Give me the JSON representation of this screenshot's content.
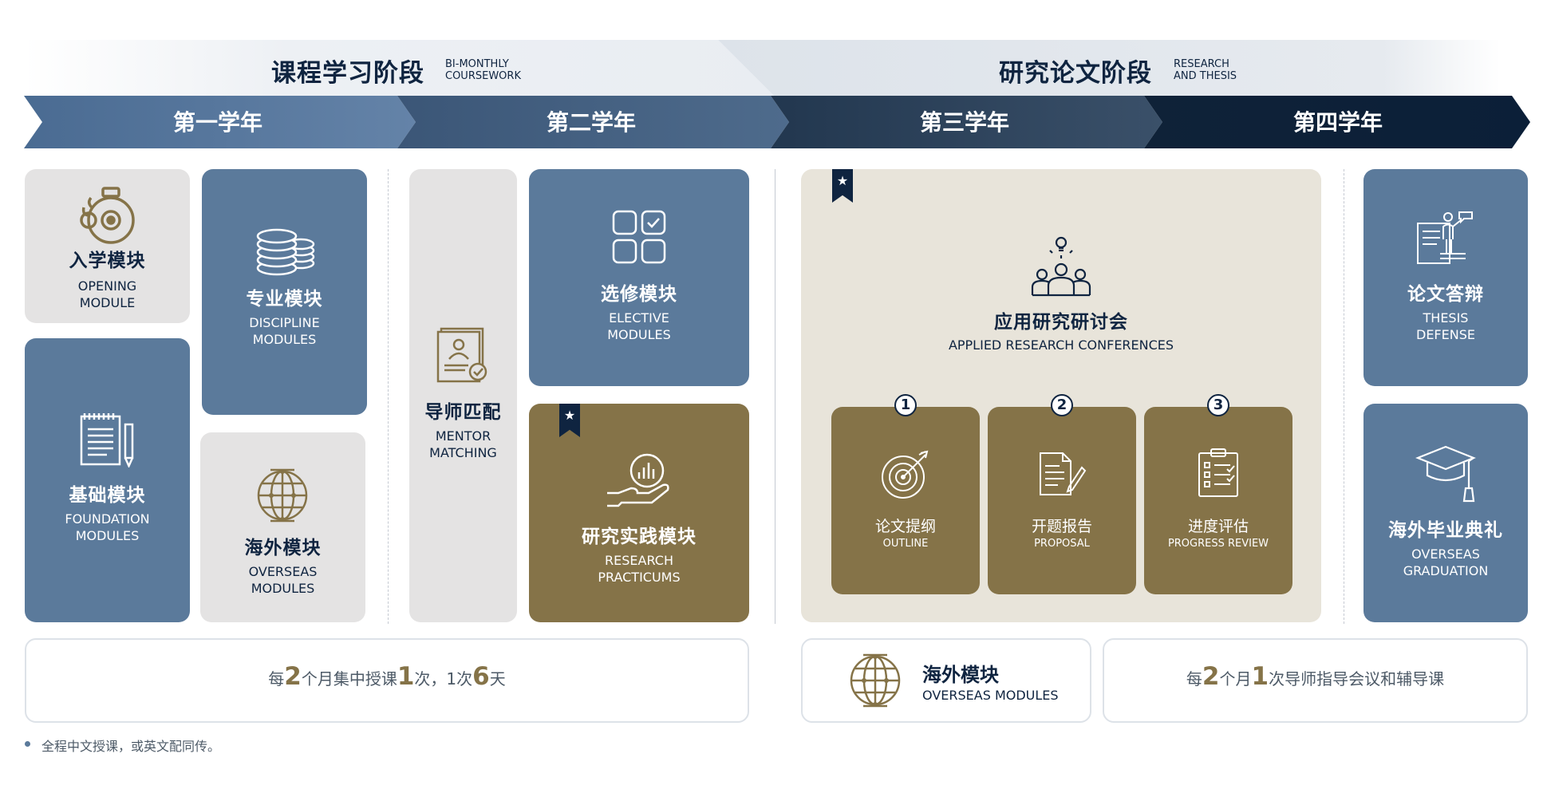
{
  "phases": [
    {
      "title": "课程学习阶段",
      "sub_line1": "BI-MONTHLY",
      "sub_line2": "COURSEWORK"
    },
    {
      "title": "研究论文阶段",
      "sub_line1": "RESEARCH",
      "sub_line2": "AND THESIS"
    }
  ],
  "years": [
    "第一学年",
    "第二学年",
    "第三学年",
    "第四学年"
  ],
  "colors": {
    "blue": "#5b7a9b",
    "grey": "#e4e3e3",
    "gold": "#857348",
    "navy": "#0f2440",
    "beige": "#e8e4da"
  },
  "modules": {
    "opening": {
      "zh": "入学模块",
      "en1": "OPENING",
      "en2": "MODULE",
      "icon": "bell-icon"
    },
    "discipline": {
      "zh": "专业模块",
      "en1": "DISCIPLINE",
      "en2": "MODULES",
      "icon": "coins-icon"
    },
    "foundation": {
      "zh": "基础模块",
      "en1": "FOUNDATION",
      "en2": "MODULES",
      "icon": "notepad-pen-icon"
    },
    "overseas": {
      "zh": "海外模块",
      "en1": "OVERSEAS",
      "en2": "MODULES",
      "icon": "globe-icon"
    },
    "mentor": {
      "zh": "导师匹配",
      "en1": "MENTOR",
      "en2": "MATCHING",
      "icon": "certificate-icon"
    },
    "elective": {
      "zh": "选修模块",
      "en1": "ELECTIVE",
      "en2": "MODULES",
      "icon": "grid-check-icon"
    },
    "practicum": {
      "zh": "研究实践模块",
      "en1": "RESEARCH",
      "en2": "PRACTICUMS",
      "icon": "hand-chart-icon"
    },
    "conference": {
      "zh": "应用研究研讨会",
      "en": "APPLIED RESEARCH CONFERENCES",
      "icon": "team-idea-icon"
    },
    "defense": {
      "zh": "论文答辩",
      "en1": "THESIS",
      "en2": "DEFENSE",
      "icon": "presenter-icon"
    },
    "graduation": {
      "zh": "海外毕业典礼",
      "en1": "OVERSEAS",
      "en2": "GRADUATION",
      "icon": "grad-cap-icon"
    }
  },
  "steps": [
    {
      "num": "1",
      "zh": "论文提纲",
      "en": "OUTLINE",
      "icon": "target-icon"
    },
    {
      "num": "2",
      "zh": "开题报告",
      "en": "PROPOSAL",
      "icon": "document-pen-icon"
    },
    {
      "num": "3",
      "zh": "进度评估",
      "en": "PROGRESS REVIEW",
      "icon": "clipboard-icon"
    }
  ],
  "bottom": {
    "left": {
      "t1": "每",
      "n1": "2",
      "t2": "个月集中授课",
      "n2": "1",
      "t3": "次，1次",
      "n3": "6",
      "t4": "天"
    },
    "overseas": {
      "zh": "海外模块",
      "en": "OVERSEAS MODULES"
    },
    "right": {
      "t1": "每",
      "n1": "2",
      "t2": "个月",
      "n2": "1",
      "t3": "次导师指导会议和辅导课"
    }
  },
  "footnote": "全程中文授课，或英文配同传。"
}
